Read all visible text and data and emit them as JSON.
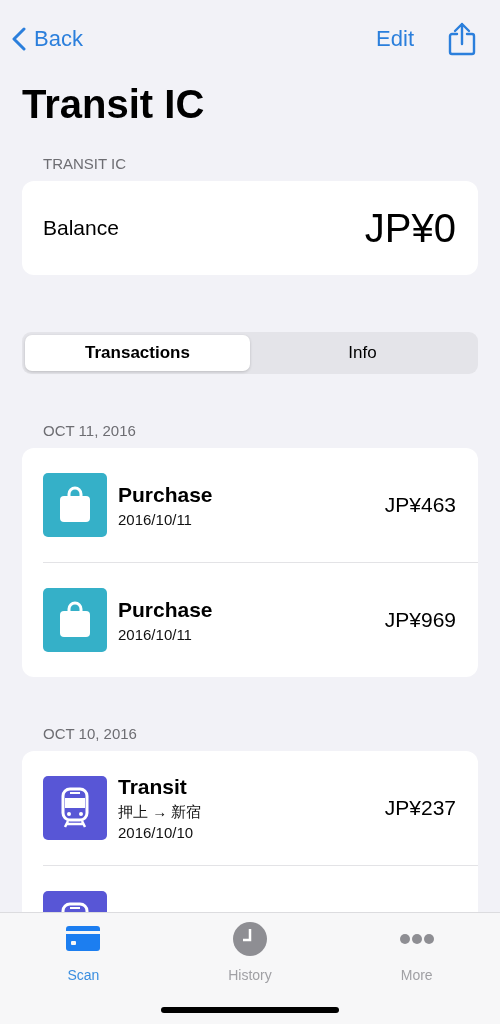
{
  "nav": {
    "back": "Back",
    "edit": "Edit"
  },
  "title": "Transit IC",
  "balance_section": {
    "header": "TRANSIT IC",
    "label": "Balance",
    "amount": "JP¥0"
  },
  "segments": [
    {
      "label": "Transactions",
      "selected": true
    },
    {
      "label": "Info",
      "selected": false
    }
  ],
  "sections": [
    {
      "date": "OCT 11, 2016",
      "transactions": [
        {
          "kind": "purchase",
          "title": "Purchase",
          "date": "2016/10/11",
          "amount": "JP¥463"
        },
        {
          "kind": "purchase",
          "title": "Purchase",
          "date": "2016/10/11",
          "amount": "JP¥969"
        }
      ]
    },
    {
      "date": "OCT 10, 2016",
      "transactions": [
        {
          "kind": "transit",
          "title": "Transit",
          "route": "押上 → 新宿",
          "date": "2016/10/10",
          "amount": "JP¥237"
        },
        {
          "kind": "transit"
        }
      ]
    }
  ],
  "tab_bar": [
    {
      "kind": "card",
      "label": "Scan",
      "selected": true
    },
    {
      "kind": "clock",
      "label": "History",
      "selected": false
    },
    {
      "kind": "more",
      "label": "More",
      "selected": false
    }
  ]
}
